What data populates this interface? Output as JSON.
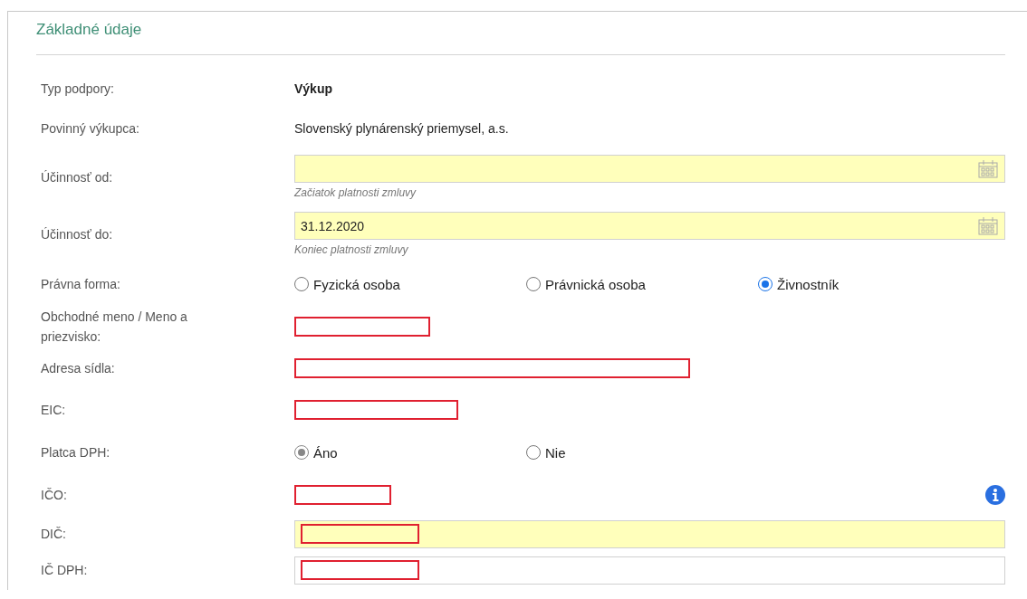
{
  "section": {
    "title": "Základné údaje"
  },
  "rows": [
    {
      "kind": "static",
      "label": "Typ podpory:",
      "value": "Výkup",
      "bold": true
    },
    {
      "kind": "static",
      "label": "Povinný výkupca:",
      "value": "Slovenský plynárenský priemysel, a.s.",
      "bold": false
    },
    {
      "kind": "date",
      "label": "Účinnosť od:",
      "hint": "Začiatok platnosti zmluvy",
      "required": true
    },
    {
      "kind": "date",
      "label": "Účinnosť do:",
      "value": "31.12.2020",
      "hint": "Koniec platnosti zmluvy",
      "required": true
    },
    {
      "kind": "radio",
      "label": "Právna forma:",
      "disabled": false,
      "options": [
        {
          "label": "Fyzická osoba",
          "selected": false
        },
        {
          "label": "Právnická osoba",
          "selected": false
        },
        {
          "label": "Živnostník",
          "selected": true
        }
      ]
    },
    {
      "kind": "redacted",
      "label": "Obchodné meno / Meno a priezvisko:",
      "info": false
    },
    {
      "kind": "redacted",
      "label": "Adresa sídla:",
      "info": false
    },
    {
      "kind": "redacted",
      "label": "EIC:",
      "info": false
    },
    {
      "kind": "radio",
      "label": "Platca DPH:",
      "disabled": true,
      "options": [
        {
          "label": "Áno",
          "selected": true
        },
        {
          "label": "Nie",
          "selected": false
        }
      ]
    },
    {
      "kind": "redacted",
      "label": "IČO:",
      "info": true
    },
    {
      "kind": "text",
      "label": "DIČ:",
      "required": true,
      "redacted": true
    },
    {
      "kind": "text",
      "label": "IČ DPH:",
      "required": false,
      "redacted": true
    }
  ]
}
